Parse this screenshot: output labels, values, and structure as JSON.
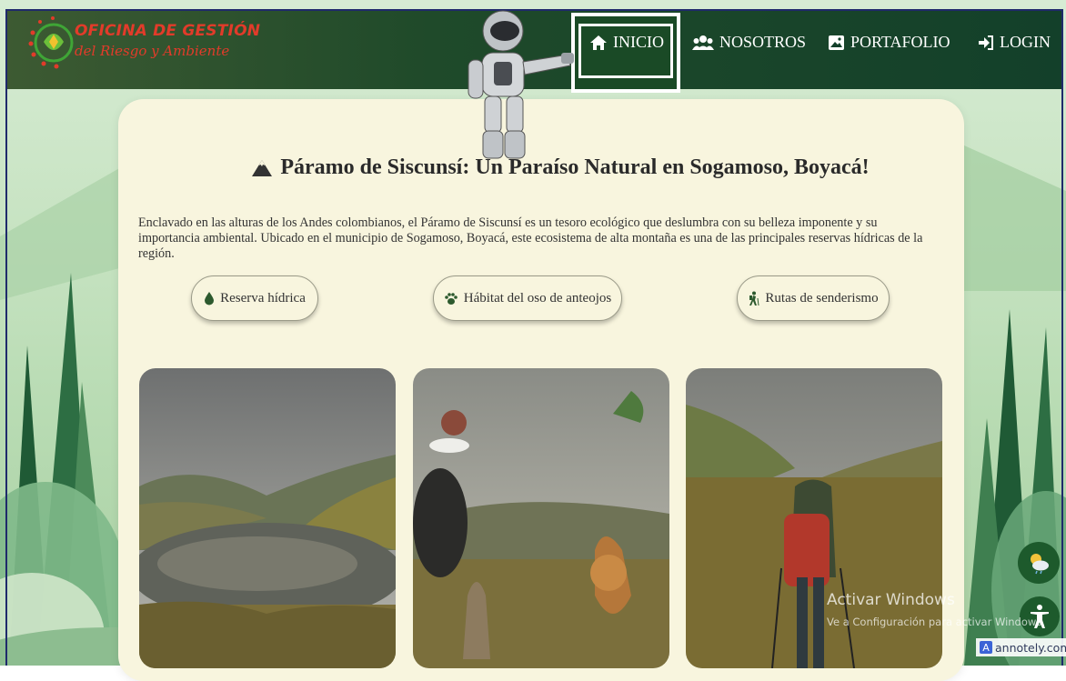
{
  "brand": {
    "line1": "OFICINA DE GESTIÓN",
    "line2": "del Riesgo y Ambiente"
  },
  "nav": [
    {
      "label": "INICIO",
      "icon": "home-icon",
      "active": true
    },
    {
      "label": "NOSOTROS",
      "icon": "users-icon"
    },
    {
      "label": "PORTAFOLIO",
      "icon": "image-icon"
    },
    {
      "label": "LOGIN",
      "icon": "login-icon"
    }
  ],
  "hero": {
    "title": "Páramo de Siscunsí: Un Paraíso Natural en Sogamoso, Boyacá!",
    "paragraph": "Enclavado en las alturas de los Andes colombianos, el Páramo de Siscunsí es un tesoro ecológico que deslumbra con su belleza imponente y su importancia ambiental. Ubicado en el municipio de Sogamoso, Boyacá, este ecosistema de alta montaña es una de las principales reservas hídricas de la región.",
    "buttons": [
      {
        "label": "Reserva hídrica",
        "icon": "water-drop-icon"
      },
      {
        "label": "Hábitat del oso de anteojos",
        "icon": "paw-icon"
      },
      {
        "label": "Rutas de senderismo",
        "icon": "hiker-icon"
      }
    ]
  },
  "photos": [
    {
      "name": "lagoon-photo"
    },
    {
      "name": "wildlife-photo"
    },
    {
      "name": "hiker-photo"
    }
  ],
  "overlay": {
    "windows_line1": "Activar Windows",
    "windows_line2": "Ve a Configuración para activar Windows.",
    "annotely": "annotely.com"
  },
  "colors": {
    "navbar": "#13402a",
    "accent": "#1d5a2c",
    "card": "#f8f5de",
    "brand_text": "#e23b2a"
  }
}
